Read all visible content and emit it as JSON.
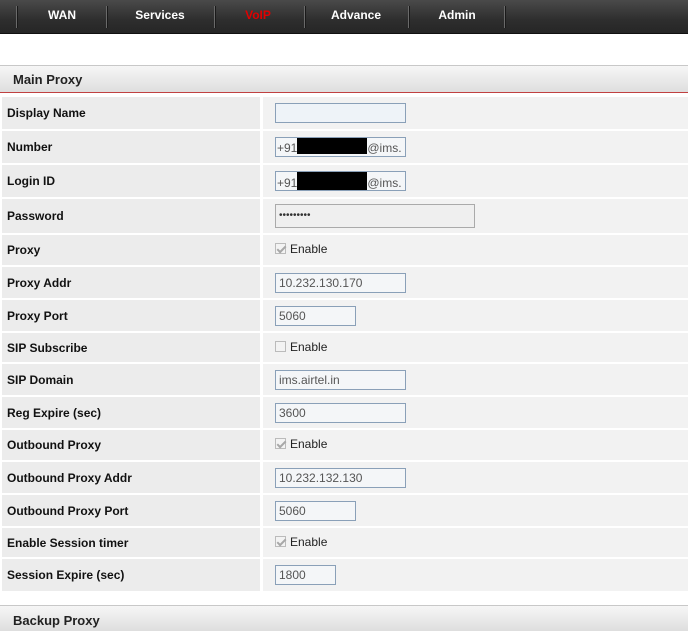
{
  "nav": {
    "items": [
      {
        "label": "WAN"
      },
      {
        "label": "Services"
      },
      {
        "label": "VoIP"
      },
      {
        "label": "Advance"
      },
      {
        "label": "Admin"
      }
    ],
    "active": "VoIP",
    "active_color": "#e00000"
  },
  "main_proxy": {
    "title": "Main Proxy",
    "display_name": {
      "label": "Display Name",
      "value": ""
    },
    "number": {
      "label": "Number",
      "prefix": "+91",
      "suffix": "@ims."
    },
    "login_id": {
      "label": "Login ID",
      "prefix": "+91",
      "suffix": "@ims."
    },
    "password": {
      "label": "Password",
      "value": "•••••••••"
    },
    "proxy": {
      "label": "Proxy",
      "checkbox_label": "Enable",
      "checked": true
    },
    "proxy_addr": {
      "label": "Proxy Addr",
      "value": "10.232.130.170"
    },
    "proxy_port": {
      "label": "Proxy Port",
      "value": "5060"
    },
    "sip_subscribe": {
      "label": "SIP Subscribe",
      "checkbox_label": "Enable",
      "checked": false
    },
    "sip_domain": {
      "label": "SIP Domain",
      "value": "ims.airtel.in"
    },
    "reg_expire": {
      "label": "Reg Expire (sec)",
      "value": "3600"
    },
    "outbound_proxy": {
      "label": "Outbound Proxy",
      "checkbox_label": "Enable",
      "checked": true
    },
    "outbound_proxy_addr": {
      "label": "Outbound Proxy Addr",
      "value": "10.232.132.130"
    },
    "outbound_proxy_port": {
      "label": "Outbound Proxy Port",
      "value": "5060"
    },
    "session_timer": {
      "label": "Enable Session timer",
      "checkbox_label": "Enable",
      "checked": true
    },
    "session_expire": {
      "label": "Session Expire (sec)",
      "value": "1800"
    }
  },
  "backup_proxy": {
    "title": "Backup Proxy"
  }
}
